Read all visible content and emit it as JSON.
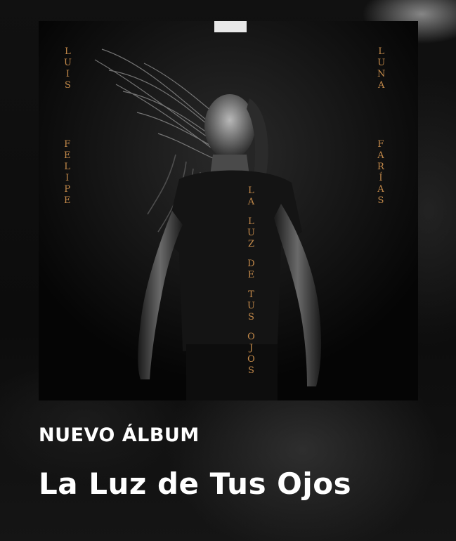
{
  "cover": {
    "artist_first": "LUIS",
    "artist_middle": "FELIPE",
    "artist_last1": "LUNA",
    "artist_last2": "FARÍAS",
    "title_words": [
      "LA",
      "LUZ",
      "DE",
      "TUS",
      "OJOS"
    ],
    "text_color": "#c48a4a"
  },
  "banner": {
    "label": "NUEVO ÁLBUM",
    "title": "La Luz de Tus Ojos"
  }
}
